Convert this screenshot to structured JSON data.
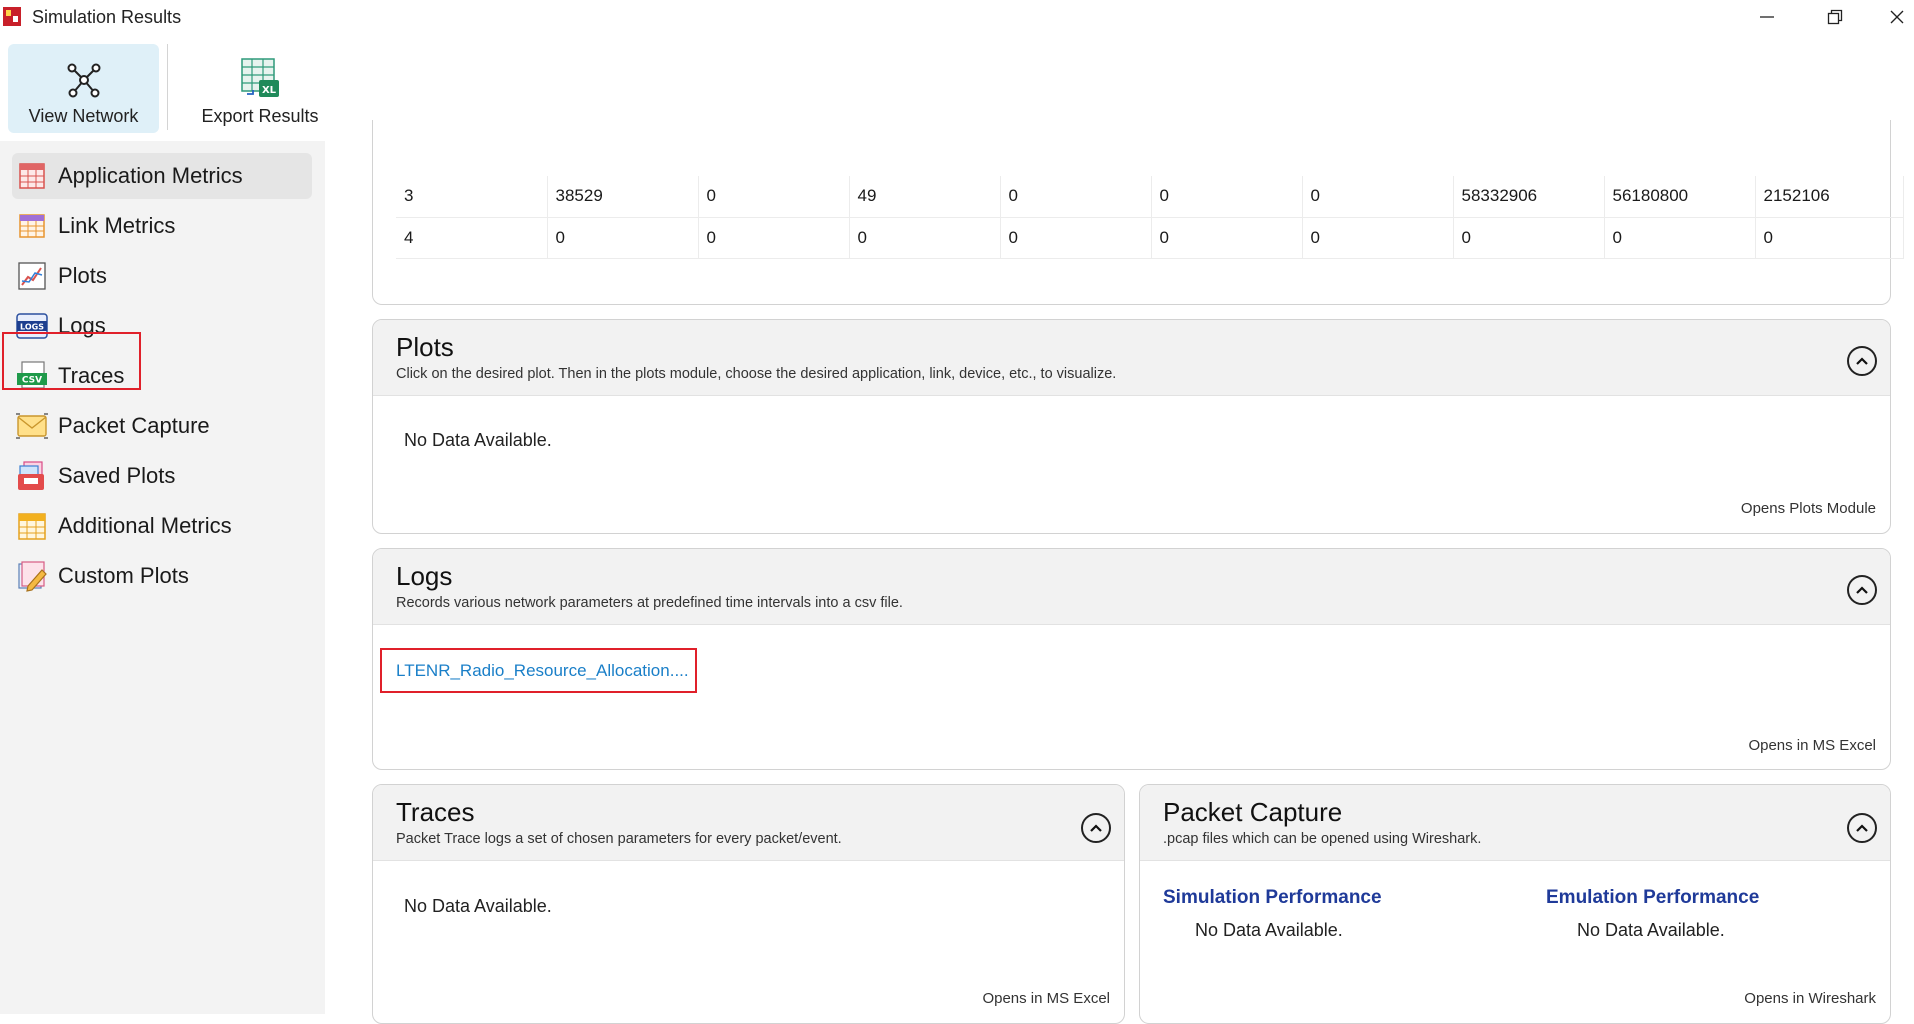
{
  "window": {
    "title": "Simulation Results",
    "minimize_glyph": "—",
    "restore_glyph": "❐",
    "close_glyph": "✕"
  },
  "toolbar": {
    "view_network_label": "View Network",
    "export_results_label": "Export Results",
    "export_badge": "XL"
  },
  "sidebar": {
    "items": [
      {
        "label": "Application Metrics",
        "icon": "spreadsheet-icon"
      },
      {
        "label": "Link Metrics",
        "icon": "spreadsheet-icon"
      },
      {
        "label": "Plots",
        "icon": "plot-icon"
      },
      {
        "label": "Logs",
        "icon": "logs-icon",
        "icon_text": "LOGS"
      },
      {
        "label": "Traces",
        "icon": "csv-icon",
        "icon_text": "CSV"
      },
      {
        "label": "Packet Capture",
        "icon": "envelope-icon"
      },
      {
        "label": "Saved Plots",
        "icon": "saved-plots-icon"
      },
      {
        "label": "Additional Metrics",
        "icon": "spreadsheet-icon"
      },
      {
        "label": "Custom Plots",
        "icon": "custom-plots-icon"
      }
    ]
  },
  "metrics_table": {
    "rows": [
      [
        "3",
        "38529",
        "0",
        "49",
        "0",
        "0",
        "0",
        "58332906",
        "56180800",
        "2152106"
      ],
      [
        "4",
        "0",
        "0",
        "0",
        "0",
        "0",
        "0",
        "0",
        "0",
        "0"
      ]
    ]
  },
  "plots": {
    "title": "Plots",
    "subtitle": "Click on the desired plot. Then in the plots module, choose the desired application, link, device, etc., to visualize.",
    "empty_text": "No Data Available.",
    "footer": "Opens Plots Module"
  },
  "logs": {
    "title": "Logs",
    "subtitle": "Records various network parameters at predefined time intervals into a csv file.",
    "file_link": "LTENR_Radio_Resource_Allocation....",
    "footer": "Opens in MS Excel"
  },
  "traces": {
    "title": "Traces",
    "subtitle": "Packet Trace logs a set of chosen parameters for every packet/event.",
    "empty_text": "No Data Available.",
    "footer": "Opens in MS Excel"
  },
  "packet_capture": {
    "title": "Packet Capture",
    "subtitle": ".pcap files which can be opened using Wireshark.",
    "simulation_title": "Simulation Performance",
    "simulation_empty": "No Data Available.",
    "emulation_title": "Emulation Performance",
    "emulation_empty": "No Data Available.",
    "footer": "Opens in Wireshark"
  },
  "colors": {
    "link": "#1a7fc8",
    "perf_title": "#1f3a99",
    "highlight": "#e0202a",
    "active_ribbon": "#dff0f8"
  }
}
